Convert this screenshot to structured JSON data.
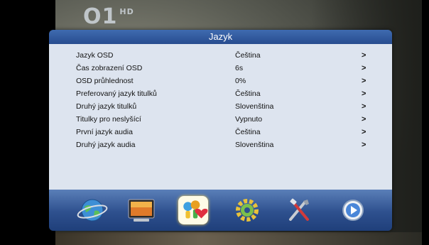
{
  "channel": {
    "logo_text": "Ο1",
    "hd_label": "HD"
  },
  "dialog": {
    "title": "Jazyk"
  },
  "settings": [
    {
      "label": "Jazyk OSD",
      "value": "Čeština",
      "arrow": ">"
    },
    {
      "label": "Čas zobrazení OSD",
      "value": "6s",
      "arrow": ">"
    },
    {
      "label": "OSD průhlednost",
      "value": "0%",
      "arrow": ">"
    },
    {
      "label": "Preferovaný jazyk titulků",
      "value": "Čeština",
      "arrow": ">"
    },
    {
      "label": "Druhý jazyk titulků",
      "value": "Slovenština",
      "arrow": ">"
    },
    {
      "label": "Titulky pro neslyšící",
      "value": "Vypnuto",
      "arrow": ">"
    },
    {
      "label": "První jazyk audia",
      "value": "Čeština",
      "arrow": ">"
    },
    {
      "label": "Druhý jazyk audia",
      "value": "Slovenština",
      "arrow": ">"
    }
  ],
  "menu_icons": [
    {
      "name": "globe-icon",
      "selected": false
    },
    {
      "name": "monitor-icon",
      "selected": false
    },
    {
      "name": "language-icon",
      "selected": true
    },
    {
      "name": "gear-icon",
      "selected": false
    },
    {
      "name": "tools-icon",
      "selected": false
    },
    {
      "name": "play-icon",
      "selected": false
    }
  ],
  "colors": {
    "title_bar": "#2f5aa0",
    "panel": "#dde4ef",
    "icon_bar": "#2e508e",
    "selection_highlight": "#fffbe6"
  }
}
